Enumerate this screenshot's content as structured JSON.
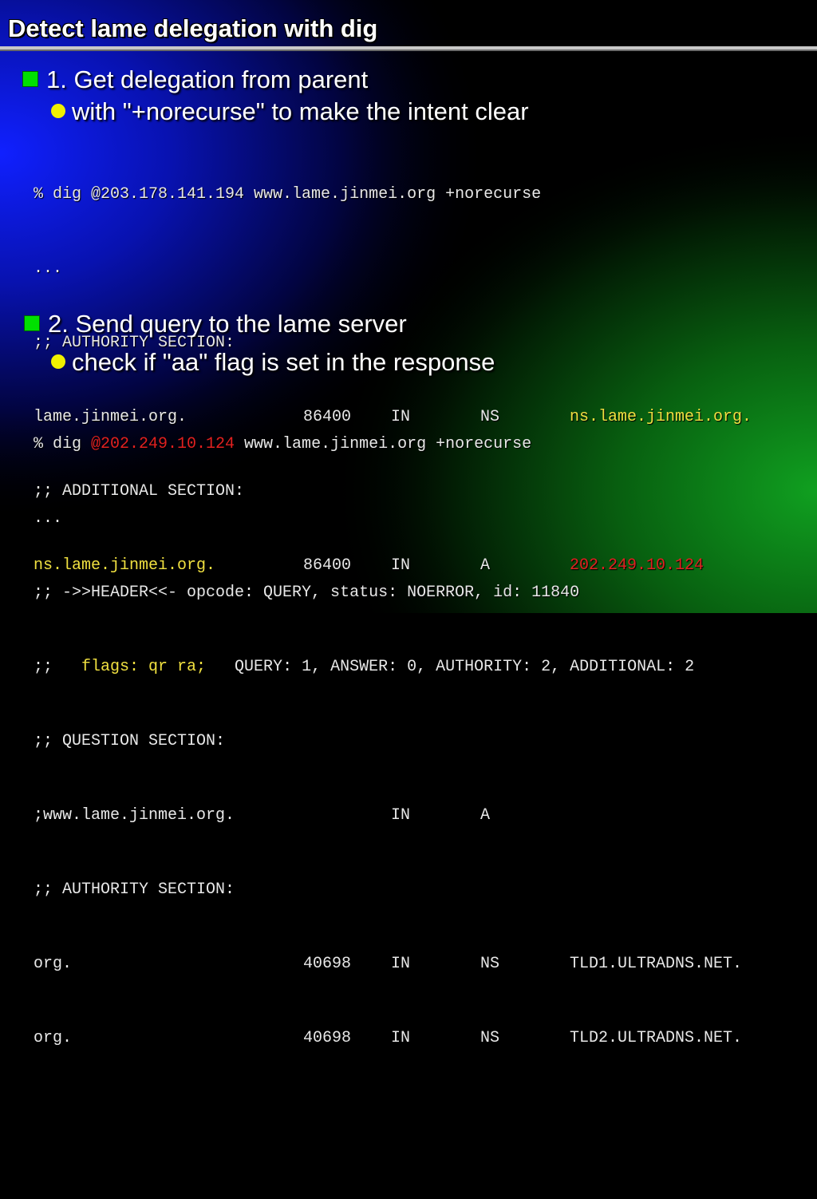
{
  "title": "Detect lame delegation with dig",
  "colors": {
    "bullet_square": "#00e000",
    "bullet_dot": "#f0f000",
    "highlight_yellow": "#f0e040",
    "highlight_red": "#e02020"
  },
  "step1": {
    "label": "1. Get delegation from parent",
    "sub": "with \"+norecurse\" to make the intent clear",
    "cmd": "% dig @203.178.141.194 www.lame.jinmei.org +norecurse",
    "ellipsis": "...",
    "authority_header": ";; AUTHORITY SECTION:",
    "ns_record": {
      "name": "lame.jinmei.org.",
      "ttl": "86400",
      "class": "IN",
      "type": "NS",
      "data": "ns.lame.jinmei.org."
    },
    "additional_header": ";; ADDITIONAL SECTION:",
    "a_record": {
      "name": "ns.lame.jinmei.org.",
      "ttl": "86400",
      "class": "IN",
      "type": "A",
      "data": "202.249.10.124"
    }
  },
  "step2": {
    "label": "2. Send query to the lame server",
    "sub": "check if \"aa\" flag is set in the response",
    "cmd_prefix": "% dig ",
    "cmd_server": "@202.249.10.124",
    "cmd_rest": " www.lame.jinmei.org +norecurse",
    "ellipsis": "...",
    "header_line": ";; ->>HEADER<<- opcode: QUERY, status: NOERROR, id: 11840",
    "flags_prefix": ";;   ",
    "flags": "flags: qr ra;",
    "flags_rest": "   QUERY: 1, ANSWER: 0, AUTHORITY: 2, ADDITIONAL: 2",
    "question_header": ";; QUESTION SECTION:",
    "question": {
      "name": ";www.lame.jinmei.org.",
      "class": "IN",
      "type": "A"
    },
    "authority_header": ";; AUTHORITY SECTION:",
    "authority": [
      {
        "name": "org.",
        "ttl": "40698",
        "class": "IN",
        "type": "NS",
        "data": "TLD1.ULTRADNS.NET."
      },
      {
        "name": "org.",
        "ttl": "40698",
        "class": "IN",
        "type": "NS",
        "data": "TLD2.ULTRADNS.NET."
      }
    ]
  }
}
